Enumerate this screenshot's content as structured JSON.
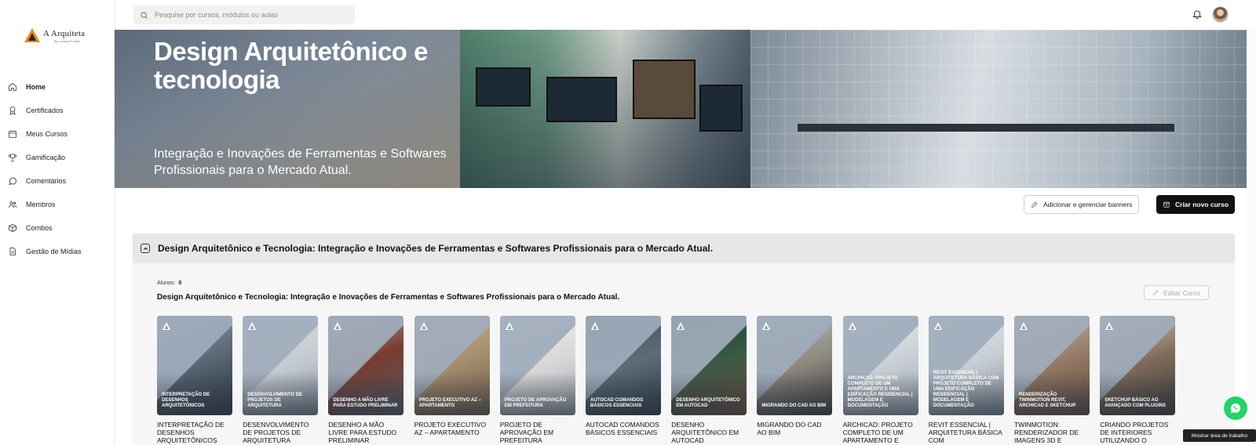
{
  "brand": {
    "name": "A Arquiteta",
    "sub": "By Luciana Fontes"
  },
  "sidebar": {
    "items": [
      {
        "label": "Home",
        "icon": "home-icon"
      },
      {
        "label": "Certificados",
        "icon": "award-icon"
      },
      {
        "label": "Meus Cursos",
        "icon": "calendar-icon"
      },
      {
        "label": "Gamificação",
        "icon": "trophy-icon"
      },
      {
        "label": "Comentários",
        "icon": "chat-icon"
      },
      {
        "label": "Membros",
        "icon": "users-icon"
      },
      {
        "label": "Combos",
        "icon": "box-icon"
      },
      {
        "label": "Gestão de Mídias",
        "icon": "file-icon"
      }
    ]
  },
  "topbar": {
    "search_placeholder": "Pesquise por cursos, módulos ou aulas"
  },
  "banner": {
    "title": "Design Arquitetônico e tecnologia",
    "subtitle": "Integração e Inovações de Ferramentas e Softwares Profissionais para o Mercado Atual."
  },
  "actions": {
    "banners_label": "Adicionar e gerenciar banners",
    "new_course_label": "Criar novo curso"
  },
  "course": {
    "section_title": "Design Arquitetônico e Tecnologia: Integração e Inovações de Ferramentas e Softwares Profissionais para o Mercado Atual.",
    "students_label": "Alunos:",
    "students_count": "0",
    "title": "Design Arquitetônico e Tecnologia: Integração e Inovações de Ferramentas e Softwares Profissionais para o Mercado Atual.",
    "edit_label": "Editar Curso",
    "modules": [
      {
        "thumb_label": "Interpretação de desenhos arquitetônicos",
        "name": "INTERPRETAÇÃO DE DESENHOS ARQUITETÔNICOS"
      },
      {
        "thumb_label": "Desenvolvimento de projetos de arquitetura",
        "name": "DESENVOLVIMENTO DE PROJETOS DE ARQUITETURA"
      },
      {
        "thumb_label": "Desenho a mão livre para estudo preliminar",
        "name": "DESENHO A MÃO LIVRE PARA ESTUDO PRELIMINAR"
      },
      {
        "thumb_label": "Projeto executivo AZ – apartamento",
        "name": "PROJETO EXECUTIVO AZ – APARTAMENTO"
      },
      {
        "thumb_label": "Projeto de aprovação em prefeitura",
        "name": "PROJETO DE APROVAÇÃO EM PREFEITURA"
      },
      {
        "thumb_label": "AutoCAD comandos básicos essenciais",
        "name": "AUTOCAD COMANDOS BÁSICOS ESSENCIAIS"
      },
      {
        "thumb_label": "Desenho arquitetônico em AutoCAD",
        "name": "DESENHO ARQUITETÔNICO EM AUTOCAD"
      },
      {
        "thumb_label": "Migrando do CAD ao BIM",
        "name": "MIGRANDO DO CAD AO BIM"
      },
      {
        "thumb_label": "ArchiCAD: projeto completo de um apartamento e uma edificação residencial | modelagem e documentação",
        "name": "ARCHICAD: PROJETO COMPLETO DE UM APARTAMENTO E"
      },
      {
        "thumb_label": "Revit essencial | arquitetura básica com projeto completo de uma edificação residencial | modelagem e documentação",
        "name": "REVIT ESSENCIAL | ARQUITETURA BÁSICA COM"
      },
      {
        "thumb_label": "Renderização Twinmotion Revit, ArchiCAD e SketchUp",
        "name": "TWINMOTION: RENDERIZADOR DE IMAGENS 3D E"
      },
      {
        "thumb_label": "SketchUp básico ao avançado com plugins",
        "name": "CRIANDO PROJETOS DE INTERIORES UTILIZANDO O"
      }
    ]
  },
  "tooltip": "Mostrar área de trabalho",
  "colors": {
    "accent": "#e88a1a",
    "dark_button": "#111111",
    "whatsapp": "#25d366",
    "section_bg": "#e7e7e7"
  }
}
